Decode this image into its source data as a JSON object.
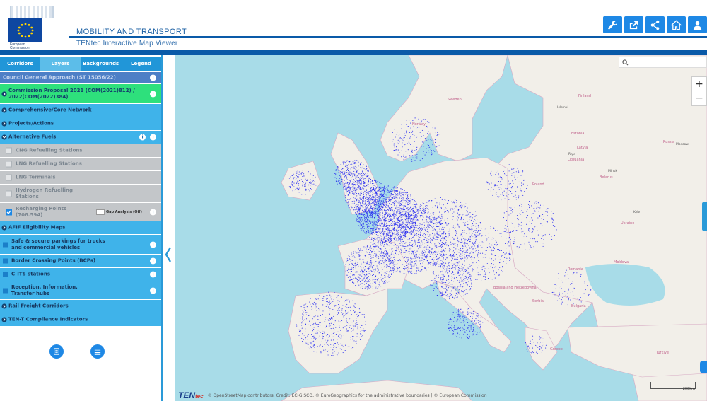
{
  "header": {
    "logo_text": "European Commission",
    "title": "MOBILITY AND TRANSPORT",
    "subtitle": "TENtec Interactive Map Viewer",
    "toolbar": [
      {
        "icon": "wrench-icon"
      },
      {
        "icon": "share-out-icon"
      },
      {
        "icon": "share-icon"
      },
      {
        "icon": "home-icon"
      },
      {
        "icon": "user-icon"
      }
    ]
  },
  "sidebar": {
    "tabs": [
      {
        "label": "Corridors",
        "active": false
      },
      {
        "label": "Layers",
        "active": true
      },
      {
        "label": "Backgrounds",
        "active": false
      },
      {
        "label": "Legend",
        "active": false
      }
    ],
    "layers": {
      "council": "Council General Approach (ST 15056/22)",
      "commission": "Commission Proposal 2021 (COM(2021)812) / 2022(COM(2022)384)",
      "comprehensive": "Comprehensive/Core Network",
      "projects": "Projects/Actions",
      "alt_fuels": "Alternative Fuels",
      "cng": "CNG Refuelling Stations",
      "lng_ref": "LNG Refuelling Stations",
      "lng_term": "LNG Terminals",
      "hydrogen": "Hydrogen Refuelling Stations",
      "recharging": "Recharging Points (706.594)",
      "gap_analysis": "Gap Analysis (Off)",
      "afif": "AFIF Eligibility Maps",
      "parkings": "Safe & secure parkings for trucks and commercial vehicles",
      "border": "Border Crossing Points (BCPs)",
      "cits": "C-ITS stations",
      "reception": "Reception, Information, Transfer hubs",
      "rail_freight": "Rail Freight Corridors",
      "tent": "TEN-T Compliance Indicators"
    }
  },
  "map": {
    "attribution_brand": "TEN",
    "attribution_brand_tail": "tec",
    "credits": "© OpenStreetMap contributors, Credit: EC-GISCO, © EuroGeographics for the administrative boundaries | © European Commission",
    "scale": "200km",
    "zoom_in": "+",
    "zoom_out": "−",
    "labels": {
      "norway": "Norway",
      "sweden": "Sweden",
      "finland": "Finland",
      "estonia": "Estonia",
      "latvia": "Latvia",
      "lithuania": "Lithuania",
      "belarus": "Belarus",
      "ukraine": "Ukraine",
      "poland": "Poland",
      "moldova": "Moldova",
      "romania": "Romania",
      "bulgaria": "Bulgaria",
      "bosnia": "Bosnia and Herzegovina",
      "serbia": "Serbia",
      "greece": "Greece",
      "turkiye": "Türkiye",
      "russia": "Russia"
    },
    "cities": {
      "moscow": "Moscow",
      "minsk": "Minsk",
      "kyiv": "Kyiv",
      "helsinki": "Helsinki",
      "riga": "Riga"
    }
  },
  "colors": {
    "brand_blue": "#0a5aa8",
    "panel_blue": "#3fb3ea",
    "green_layer": "#2ee07c",
    "sea": "#a8dce8",
    "points": "#2233ee"
  }
}
